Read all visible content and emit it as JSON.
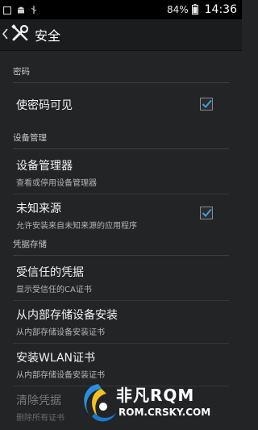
{
  "status_bar": {
    "battery_text": "84%",
    "clock": "14:36",
    "icons": [
      "square-notification-icon",
      "android-icon",
      "usb-icon",
      "battery-icon"
    ]
  },
  "action_bar": {
    "title": "安全",
    "icons": [
      "back-chevron-icon",
      "settings-tools-icon"
    ]
  },
  "sections": [
    {
      "header": "密码",
      "items": [
        {
          "title": "使密码可见",
          "subtitle": "",
          "checkbox": true
        }
      ]
    },
    {
      "header": "设备管理",
      "items": [
        {
          "title": "设备管理器",
          "subtitle": "查看或停用设备管理器",
          "checkbox": null
        },
        {
          "title": "未知来源",
          "subtitle": "允许安装来自未知来源的应用程序",
          "checkbox": true
        }
      ]
    },
    {
      "header": "凭据存储",
      "items": [
        {
          "title": "受信任的凭据",
          "subtitle": "显示受信任的CA证书",
          "checkbox": null
        },
        {
          "title": "从内部存储设备安装",
          "subtitle": "从内部存储设备安装证书",
          "checkbox": null
        },
        {
          "title": "安装WLAN证书",
          "subtitle": "从内部存储设备安装证书",
          "checkbox": null
        },
        {
          "title": "清除凭据",
          "subtitle": "删除所有证书",
          "checkbox": null,
          "disabled": true
        }
      ]
    }
  ],
  "watermark": {
    "logo_text": "非凡RQM",
    "url": "ROM.CRSKY.COM"
  },
  "colors": {
    "background": "#222426",
    "accent_check": "#3ba4d8",
    "header_text": "#c8c8c8"
  }
}
